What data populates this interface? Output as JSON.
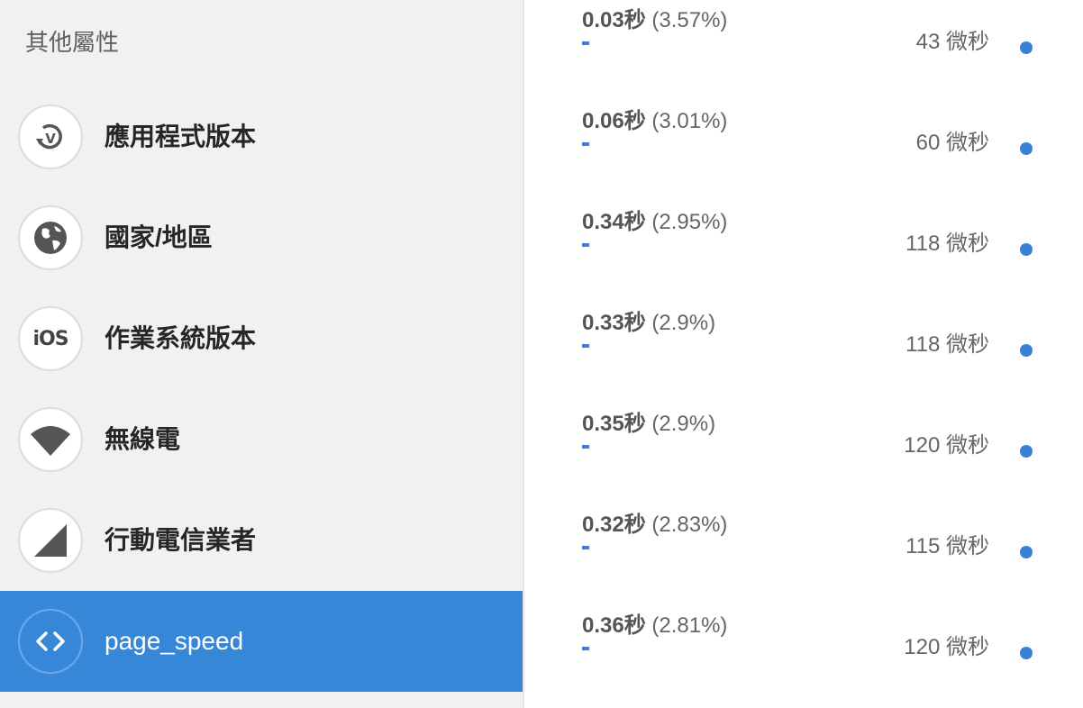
{
  "sidebar": {
    "section_title": "其他屬性",
    "items": [
      {
        "label": "應用程式版本",
        "icon": "app-version-icon"
      },
      {
        "label": "國家/地區",
        "icon": "globe-icon"
      },
      {
        "label": "作業系統版本",
        "icon": "ios-icon",
        "icon_text": "iOS"
      },
      {
        "label": "無線電",
        "icon": "wifi-signal-icon"
      },
      {
        "label": "行動電信業者",
        "icon": "cellular-signal-icon"
      },
      {
        "label": "page_speed",
        "icon": "code-brackets-icon",
        "selected": true
      }
    ]
  },
  "stats": {
    "rows": [
      {
        "value": "0.03秒",
        "percent": "(3.57%)",
        "count": "43 微秒"
      },
      {
        "value": "0.06秒",
        "percent": "(3.01%)",
        "count": "60 微秒"
      },
      {
        "value": "0.34秒",
        "percent": "(2.95%)",
        "count": "118 微秒"
      },
      {
        "value": "0.33秒",
        "percent": "(2.9%)",
        "count": "118 微秒"
      },
      {
        "value": "0.35秒",
        "percent": "(2.9%)",
        "count": "120 微秒"
      },
      {
        "value": "0.32秒",
        "percent": "(2.83%)",
        "count": "115 微秒"
      },
      {
        "value": "0.36秒",
        "percent": "(2.81%)",
        "count": "120 微秒"
      }
    ]
  },
  "colors": {
    "sidebar_bg": "#f1f1f1",
    "selected_bg": "#3787d8",
    "accent_blue": "#3a80d6",
    "icon_gray": "#555555"
  }
}
